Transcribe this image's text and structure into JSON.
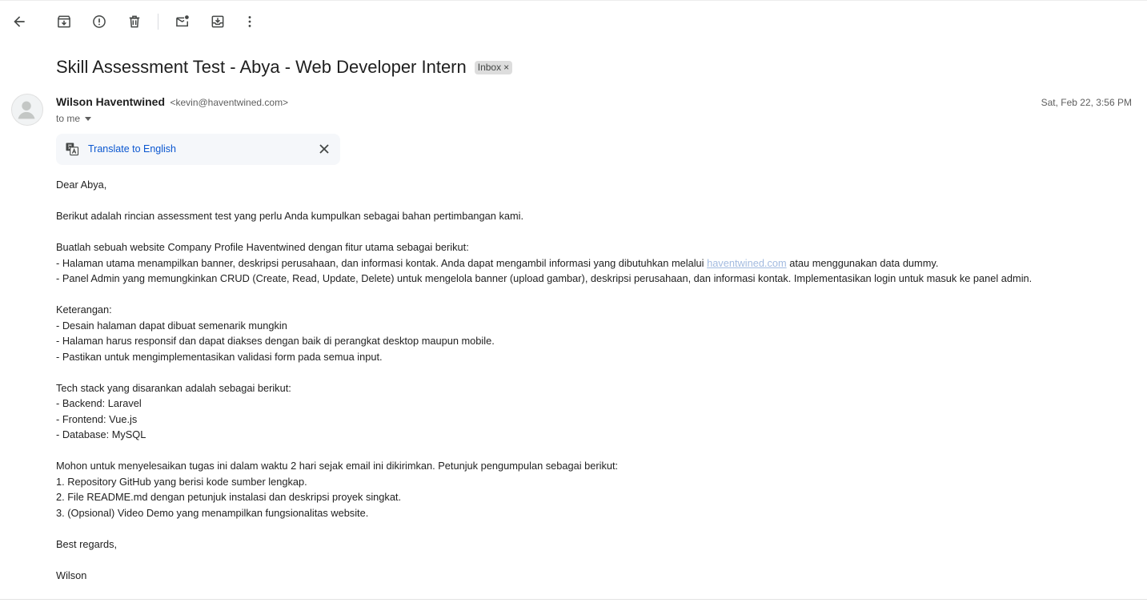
{
  "toolbar": {
    "icons": [
      "back-arrow-icon",
      "archive-icon",
      "report-spam-icon",
      "delete-icon",
      "mark-unread-icon",
      "move-to-icon",
      "more-options-icon"
    ]
  },
  "email": {
    "subject": "Skill Assessment Test - Abya - Web Developer Intern",
    "label": "Inbox",
    "label_remove": "×",
    "sender_name": "Wilson Haventwined",
    "sender_email": "<kevin@haventwined.com>",
    "date": "Sat, Feb 22, 3:56 PM",
    "to": "to me"
  },
  "translate": {
    "link": "Translate to English"
  },
  "body": {
    "greeting": "Dear Abya,",
    "intro": "Berikut adalah rincian assessment test yang perlu Anda kumpulkan sebagai bahan pertimbangan kami.",
    "task_intro": "Buatlah sebuah website Company Profile Haventwined dengan fitur utama sebagai berikut:",
    "task1_pre": "- Halaman utama menampilkan banner, deskripsi perusahaan, dan informasi kontak. Anda dapat mengambil informasi yang dibutuhkan melalui ",
    "task1_link": "haventwined.com",
    "task1_post": " atau menggunakan data dummy.",
    "task2": "- Panel Admin yang memungkinkan CRUD (Create, Read, Update, Delete) untuk mengelola banner (upload gambar), deskripsi perusahaan, dan informasi kontak. Implementasikan login untuk masuk ke panel admin.",
    "notes_title": "Keterangan:",
    "note1": "- Desain halaman dapat dibuat semenarik mungkin",
    "note2": "- Halaman harus responsif dan dapat diakses dengan baik di perangkat desktop maupun mobile.",
    "note3": "- Pastikan untuk mengimplementasikan validasi form pada semua input.",
    "stack_title": "Tech stack yang disarankan adalah sebagai berikut:",
    "stack1": "- Backend: Laravel",
    "stack2": "- Frontend: Vue.js",
    "stack3": "- Database: MySQL",
    "submit_intro": "Mohon untuk menyelesaikan tugas ini dalam waktu 2 hari sejak email ini dikirimkan. Petunjuk pengumpulan sebagai berikut:",
    "submit1": "1. Repository GitHub yang berisi kode sumber lengkap.",
    "submit2": "2. File README.md dengan petunjuk instalasi dan deskripsi proyek singkat.",
    "submit3": "3. (Opsional) Video Demo yang menampilkan fungsionalitas website.",
    "closing": "Best regards,",
    "signature": "Wilson"
  }
}
